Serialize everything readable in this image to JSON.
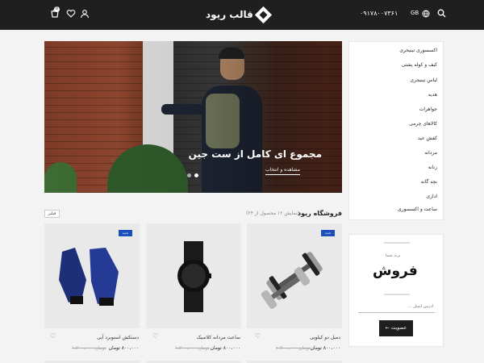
{
  "header": {
    "logo_text": "قالب ریود",
    "phone": "۰۹۱۷۸۰۰۷۳۶۱",
    "lang": "GB",
    "cart_count": "0",
    "icons": [
      "search-icon",
      "globe-icon",
      "user-icon",
      "heart-icon",
      "cart-icon"
    ]
  },
  "hero": {
    "title": "مجموع ای کامل از ست جین",
    "cta": "مشاهده و انتخاب"
  },
  "categories": [
    "اکسسوری تینیجری",
    "کیف و کوله پشتی",
    "لباس تینیجری",
    "هدیه",
    "جواهرات",
    "کالاهای چرمی",
    "کفش عید",
    "مردانه",
    "زنانه",
    "بچه گانه",
    "اداری",
    "ساعت و اکسسوری"
  ],
  "shop": {
    "title": "فروشگاه ریود",
    "count": "(نمایش ۱۲ محصول از ۲۴)",
    "filter": "فیلتر"
  },
  "products": [
    {
      "badge": "جدید",
      "name": "دستکش اسنوبرد آبی",
      "price": "۸۰۰،۰۰۰ تومان",
      "old_price": "۱،۲۰۰،۰۰۰ تومان"
    },
    {
      "badge": "",
      "name": "ساعت مردانه کلاسیک",
      "price": "۸۰۰،۰۰۰ تومان",
      "old_price": "۱،۲۰۰،۰۰۰ تومان"
    },
    {
      "badge": "جدید",
      "name": "دمبل دو کیلویی",
      "price": "۸۰۰،۰۰۰ تومان",
      "old_price": "۱،۲۰۰،۰۰۰ تومان"
    }
  ],
  "newsletter": {
    "brand_small": "برند شما",
    "word": "فروش",
    "email_placeholder": "آدرس ایمیل ...",
    "button": "عضویت"
  }
}
